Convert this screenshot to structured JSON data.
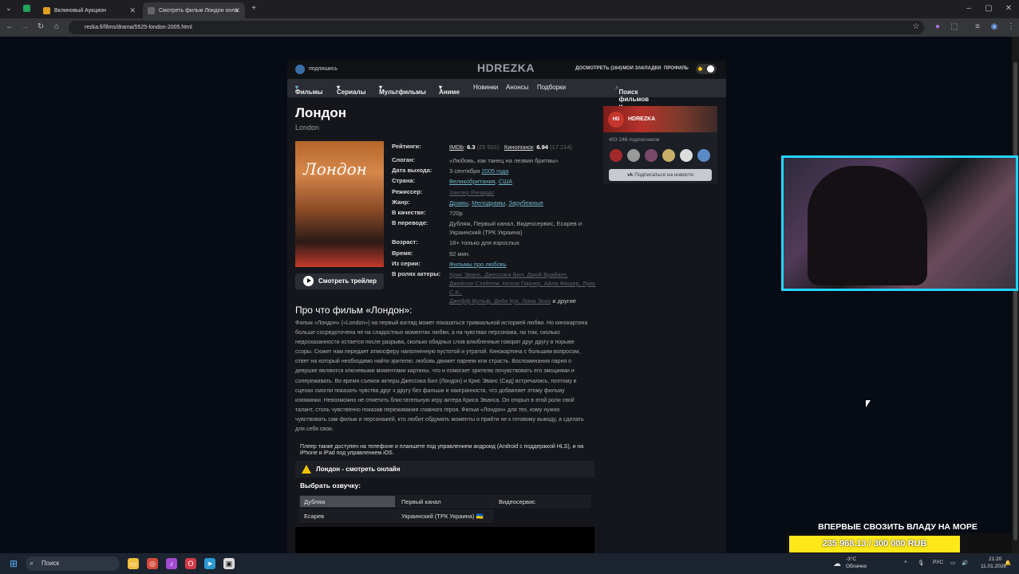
{
  "browser": {
    "tabs": [
      {
        "title": "Вклиновый Аукцион"
      },
      {
        "title": "Смотреть фильм Лондон онла"
      }
    ],
    "url": "rezka.fi/films/drama/5525-london-2005.html"
  },
  "site": {
    "subscribe": "подпишись",
    "logo": "HDREZKA",
    "watch_later": "ДОСМОТРЕТЬ",
    "watch_later_count": "(164)",
    "bookmarks": "МОИ ЗАКЛАДКИ",
    "profile": "ПРОФИЛЬ",
    "nav": [
      "Фильмы",
      "Сериалы",
      "Мультфильмы",
      "Аниме",
      "Новинки",
      "Анонсы",
      "Подборки"
    ],
    "search_placeholder": "Поиск фильмов и сериалов"
  },
  "movie": {
    "title": "Лондон",
    "original": "London",
    "poster_title": "Лондон",
    "trailer": "Смотреть трейлер",
    "labels": {
      "ratings": "Рейтинги:",
      "slogan": "Слоган:",
      "release": "Дата выхода:",
      "country": "Страна:",
      "director": "Режиссер:",
      "genre": "Жанр:",
      "quality": "В качестве:",
      "translation": "В переводе:",
      "age": "Возраст:",
      "time": "Время:",
      "series": "Из серии:",
      "actors": "В ролях актеры:"
    },
    "imdb": "IMDb",
    "imdb_score": "6.3",
    "imdb_votes": "(25 501)",
    "kp": "Кинопоиск",
    "kp_score": "6.94",
    "kp_votes": "(17 214)",
    "slogan": "«Любовь, как танец на лезвии бритвы»",
    "release_date": "3 сентября",
    "release_year": "2005 года",
    "country_1": "Великобритания",
    "country_2": "США",
    "director": "Хантер Ричардс",
    "genres": [
      "Драмы",
      "Мелодрамы",
      "Зарубежные"
    ],
    "quality": "720p",
    "translation": "Дубляж, Первый канал, Видеосервис, Есарев и Украинский (ТРК Украина)",
    "age": "18+ только для взрослых",
    "time": "92 мин.",
    "series": "Фильмы про любовь",
    "actors_line1": "Крис Эванс, Джессика Бил, Джой Брайант,",
    "actors_line2": "Джейсон Стейтем, Келли Гарнер, Айла Фишер, Луис С.К.,",
    "actors_line3": "Джефф Вульф, Дейн Кук, Лина Эско",
    "actors_more": "и другие"
  },
  "about": {
    "heading": "Про что фильм «Лондон»:",
    "text": "Фильм «Лондон» («London») на первый взгляд может показаться тривиальной историей любви. Но кинокартина больше сосредоточена не на сладостных моментах любви, а на чувствах персонажа, на том, сколько недосказанности остается после разрыва, сколько обидных слов влюбленные говорят друг другу в порыве ссоры. Сюжет нам передает атмосферу наполненную пустотой и утратой. Кинокартина с большим вопросом, ответ на который необходимо найти зрителю: любовь движет парнем или страсть. Воспоминания парня о девушке являются ключевыми моментами картины, что и помогает зрителю почувствовать его эмоциями и сопереживать. Во время съемок актеры Джессика Бил (Лондон) и Крис Эванс (Сид) встречались, поэтому в сценах смогли показать чувства друг к другу без фальши и наигранности, что добавляет этому фильму изюминки. Невозможно не отметить блистательную игру актера Криса Эванса. Он открыл в этой роли свой талант, столь чувственно показав переживания главного героя. Фильм «Лондон» для тех, кому нужно чувствовать сам фильм и персонажей, кто любит обдумать моменты и прийти не к готовому выводу, а сделать для себя свои."
  },
  "player": {
    "note": "Плеер также доступен на телефоне и планшете под управлением андроид (Android с поддержкой HLS), и на iPhone и iPad под управлением iOS.",
    "title": "Лондон - смотреть онлайн",
    "voice_label": "Выбрать озвучку:",
    "voices": [
      "Дубляж",
      "Первый канал",
      "Видеосервис",
      "Есарев",
      "Украинский (ТРК Украина) 🇺🇦"
    ]
  },
  "sidebar": {
    "name": "HDREZKA",
    "subscribers": "403 246 подписчиков",
    "vk_button": "Подписаться на новости"
  },
  "overlay": {
    "donate_title": "ВПЕРВЫЕ СВОЗИТЬ ВЛАДУ НА МОРЕ",
    "donate_amount": "235 968.13 / 300 000 RUB",
    "donate_progress": 0.787
  },
  "taskbar": {
    "search": "Поиск",
    "weather_temp": "-3°C",
    "weather_text": "Облачно",
    "lang": "РУС",
    "time": "21:20",
    "date": "11.01.2026"
  },
  "colors": {
    "accent_link": "#6fb3c9",
    "overlay_border": "#25d4ff",
    "donate_bar": "#ffe81a"
  }
}
